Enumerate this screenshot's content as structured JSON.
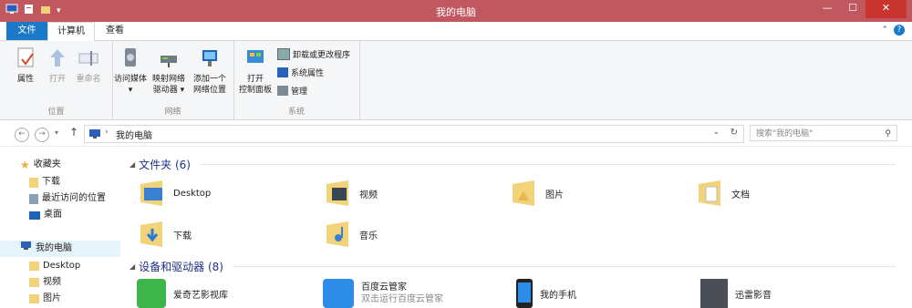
{
  "window": {
    "title": "我的电脑"
  },
  "ribbon_tabs": {
    "file": "文件",
    "computer": "计算机",
    "view": "查看"
  },
  "location_group": {
    "label": "位置",
    "properties": "属性",
    "open": "打开",
    "rename": "重命名"
  },
  "network_group": {
    "label": "网络",
    "access_media": "访问媒体",
    "map_drive_1": "映射网络",
    "map_drive_2": "驱动器",
    "add_location_1": "添加一个",
    "add_location_2": "网络位置"
  },
  "system_group": {
    "label": "系统",
    "control_panel_1": "打开",
    "control_panel_2": "控制面板",
    "uninstall": "卸载或更改程序",
    "system_props": "系统属性",
    "manage": "管理"
  },
  "address": {
    "path": "我的电脑",
    "search_placeholder": "搜索\"我的电脑\""
  },
  "sidebar": {
    "favorites": "收藏夹",
    "downloads": "下载",
    "recent": "最近访问的位置",
    "desktop": "桌面",
    "this_pc": "我的电脑",
    "pc_desktop": "Desktop",
    "pc_videos": "视频",
    "pc_pictures": "图片"
  },
  "folders": {
    "header": "文件夹 (6)",
    "items": [
      "Desktop",
      "视频",
      "图片",
      "文档",
      "下载",
      "音乐"
    ]
  },
  "devices": {
    "header": "设备和驱动器 (8)",
    "items": [
      {
        "name": "爱奇艺影视库",
        "sub": ""
      },
      {
        "name": "百度云管家",
        "sub": "双击运行百度云管家"
      },
      {
        "name": "我的手机",
        "sub": ""
      },
      {
        "name": "迅雷影音",
        "sub": ""
      }
    ]
  },
  "colors": {
    "titlebar": "#c1585f",
    "accent": "#1a79c8",
    "section": "#1e3287"
  }
}
